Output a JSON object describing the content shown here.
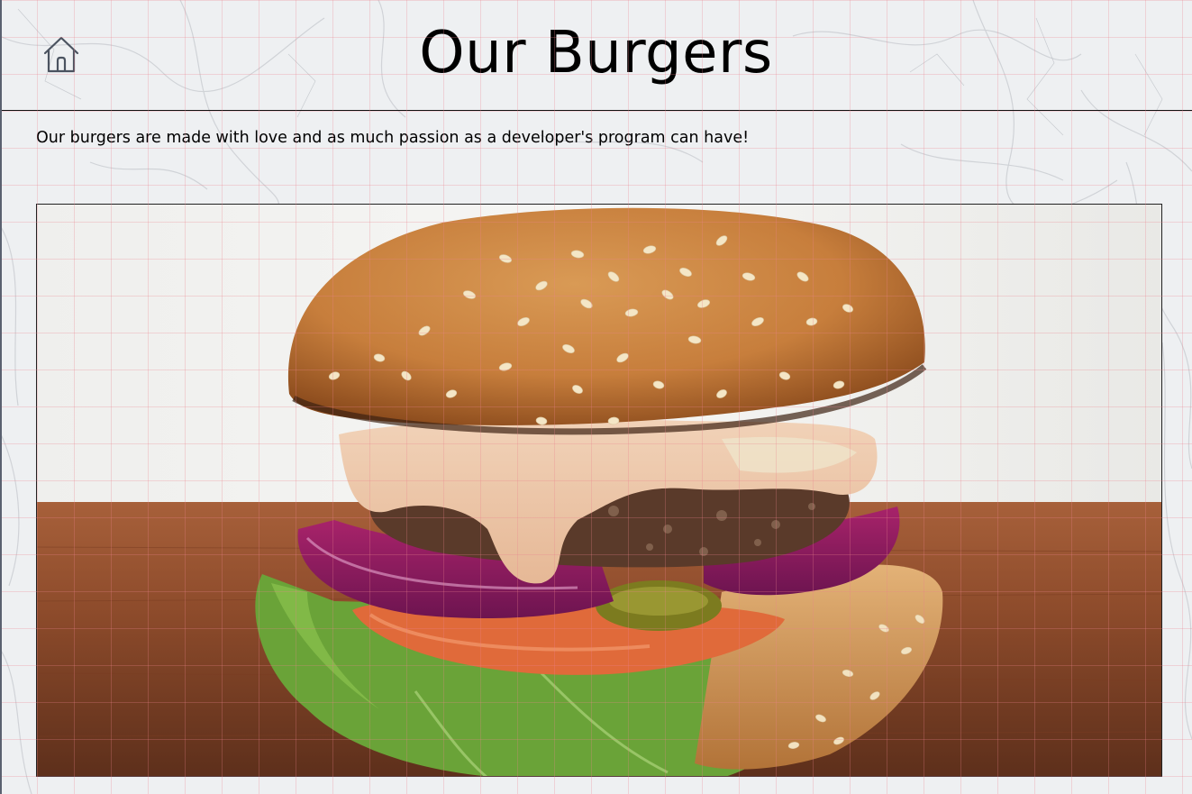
{
  "header": {
    "home_icon": "home-icon",
    "title": "Our Burgers"
  },
  "intro": {
    "text": "Our burgers are made with love and as much passion as a developer's program can have!"
  },
  "hero_image": {
    "subject": "burger-photo"
  },
  "colors": {
    "background": "#eef0f2",
    "text": "#000000",
    "grid_line": "#eb828c",
    "icon_stroke": "#4b5360"
  }
}
